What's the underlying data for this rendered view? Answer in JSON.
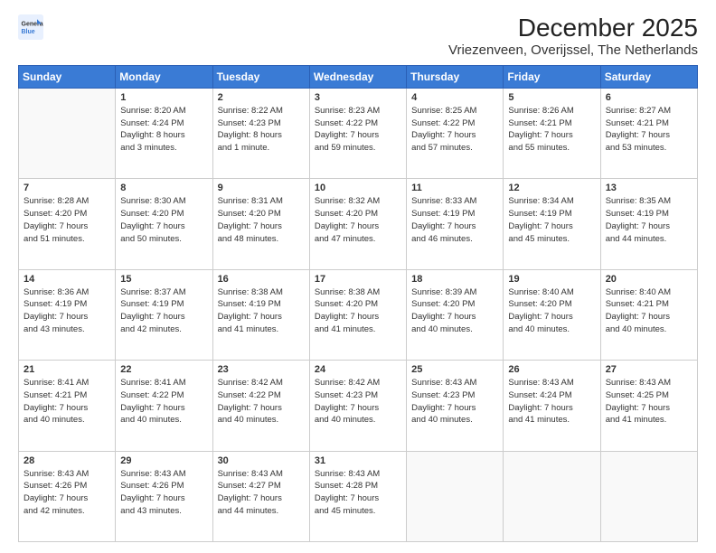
{
  "logo": {
    "line1": "General",
    "line2": "Blue"
  },
  "header": {
    "month": "December 2025",
    "location": "Vriezenveen, Overijssel, The Netherlands"
  },
  "weekdays": [
    "Sunday",
    "Monday",
    "Tuesday",
    "Wednesday",
    "Thursday",
    "Friday",
    "Saturday"
  ],
  "weeks": [
    [
      {
        "day": "",
        "info": ""
      },
      {
        "day": "1",
        "info": "Sunrise: 8:20 AM\nSunset: 4:24 PM\nDaylight: 8 hours\nand 3 minutes."
      },
      {
        "day": "2",
        "info": "Sunrise: 8:22 AM\nSunset: 4:23 PM\nDaylight: 8 hours\nand 1 minute."
      },
      {
        "day": "3",
        "info": "Sunrise: 8:23 AM\nSunset: 4:22 PM\nDaylight: 7 hours\nand 59 minutes."
      },
      {
        "day": "4",
        "info": "Sunrise: 8:25 AM\nSunset: 4:22 PM\nDaylight: 7 hours\nand 57 minutes."
      },
      {
        "day": "5",
        "info": "Sunrise: 8:26 AM\nSunset: 4:21 PM\nDaylight: 7 hours\nand 55 minutes."
      },
      {
        "day": "6",
        "info": "Sunrise: 8:27 AM\nSunset: 4:21 PM\nDaylight: 7 hours\nand 53 minutes."
      }
    ],
    [
      {
        "day": "7",
        "info": "Sunrise: 8:28 AM\nSunset: 4:20 PM\nDaylight: 7 hours\nand 51 minutes."
      },
      {
        "day": "8",
        "info": "Sunrise: 8:30 AM\nSunset: 4:20 PM\nDaylight: 7 hours\nand 50 minutes."
      },
      {
        "day": "9",
        "info": "Sunrise: 8:31 AM\nSunset: 4:20 PM\nDaylight: 7 hours\nand 48 minutes."
      },
      {
        "day": "10",
        "info": "Sunrise: 8:32 AM\nSunset: 4:20 PM\nDaylight: 7 hours\nand 47 minutes."
      },
      {
        "day": "11",
        "info": "Sunrise: 8:33 AM\nSunset: 4:19 PM\nDaylight: 7 hours\nand 46 minutes."
      },
      {
        "day": "12",
        "info": "Sunrise: 8:34 AM\nSunset: 4:19 PM\nDaylight: 7 hours\nand 45 minutes."
      },
      {
        "day": "13",
        "info": "Sunrise: 8:35 AM\nSunset: 4:19 PM\nDaylight: 7 hours\nand 44 minutes."
      }
    ],
    [
      {
        "day": "14",
        "info": "Sunrise: 8:36 AM\nSunset: 4:19 PM\nDaylight: 7 hours\nand 43 minutes."
      },
      {
        "day": "15",
        "info": "Sunrise: 8:37 AM\nSunset: 4:19 PM\nDaylight: 7 hours\nand 42 minutes."
      },
      {
        "day": "16",
        "info": "Sunrise: 8:38 AM\nSunset: 4:19 PM\nDaylight: 7 hours\nand 41 minutes."
      },
      {
        "day": "17",
        "info": "Sunrise: 8:38 AM\nSunset: 4:20 PM\nDaylight: 7 hours\nand 41 minutes."
      },
      {
        "day": "18",
        "info": "Sunrise: 8:39 AM\nSunset: 4:20 PM\nDaylight: 7 hours\nand 40 minutes."
      },
      {
        "day": "19",
        "info": "Sunrise: 8:40 AM\nSunset: 4:20 PM\nDaylight: 7 hours\nand 40 minutes."
      },
      {
        "day": "20",
        "info": "Sunrise: 8:40 AM\nSunset: 4:21 PM\nDaylight: 7 hours\nand 40 minutes."
      }
    ],
    [
      {
        "day": "21",
        "info": "Sunrise: 8:41 AM\nSunset: 4:21 PM\nDaylight: 7 hours\nand 40 minutes."
      },
      {
        "day": "22",
        "info": "Sunrise: 8:41 AM\nSunset: 4:22 PM\nDaylight: 7 hours\nand 40 minutes."
      },
      {
        "day": "23",
        "info": "Sunrise: 8:42 AM\nSunset: 4:22 PM\nDaylight: 7 hours\nand 40 minutes."
      },
      {
        "day": "24",
        "info": "Sunrise: 8:42 AM\nSunset: 4:23 PM\nDaylight: 7 hours\nand 40 minutes."
      },
      {
        "day": "25",
        "info": "Sunrise: 8:43 AM\nSunset: 4:23 PM\nDaylight: 7 hours\nand 40 minutes."
      },
      {
        "day": "26",
        "info": "Sunrise: 8:43 AM\nSunset: 4:24 PM\nDaylight: 7 hours\nand 41 minutes."
      },
      {
        "day": "27",
        "info": "Sunrise: 8:43 AM\nSunset: 4:25 PM\nDaylight: 7 hours\nand 41 minutes."
      }
    ],
    [
      {
        "day": "28",
        "info": "Sunrise: 8:43 AM\nSunset: 4:26 PM\nDaylight: 7 hours\nand 42 minutes."
      },
      {
        "day": "29",
        "info": "Sunrise: 8:43 AM\nSunset: 4:26 PM\nDaylight: 7 hours\nand 43 minutes."
      },
      {
        "day": "30",
        "info": "Sunrise: 8:43 AM\nSunset: 4:27 PM\nDaylight: 7 hours\nand 44 minutes."
      },
      {
        "day": "31",
        "info": "Sunrise: 8:43 AM\nSunset: 4:28 PM\nDaylight: 7 hours\nand 45 minutes."
      },
      {
        "day": "",
        "info": ""
      },
      {
        "day": "",
        "info": ""
      },
      {
        "day": "",
        "info": ""
      }
    ]
  ]
}
